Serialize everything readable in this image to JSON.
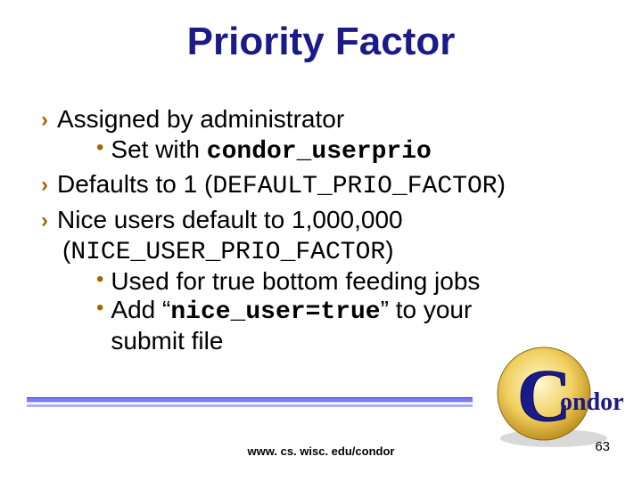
{
  "title": "Priority Factor",
  "bullets": {
    "b0": {
      "text": "Assigned by administrator"
    },
    "b0_sub0": {
      "prefix": "Set with ",
      "code": "condor_userprio"
    },
    "b1": {
      "prefix": "Defaults to 1 (",
      "code": "DEFAULT_PRIO_FACTOR",
      "suffix": ")"
    },
    "b2": {
      "text": "Nice users default to 1,000,000"
    },
    "b2_paren": {
      "open": "(",
      "code": "NICE_USER_PRIO_FACTOR",
      "close": ")"
    },
    "b2_sub0": {
      "text": "Used for true bottom feeding jobs"
    },
    "b2_sub1": {
      "prefix": "Add “",
      "code": "nice_user=true",
      "suffix": "” to your submit file"
    }
  },
  "logo": {
    "word_rest": "ondor"
  },
  "footer": {
    "url": "www. cs. wisc. edu/condor"
  },
  "page_number": "63"
}
